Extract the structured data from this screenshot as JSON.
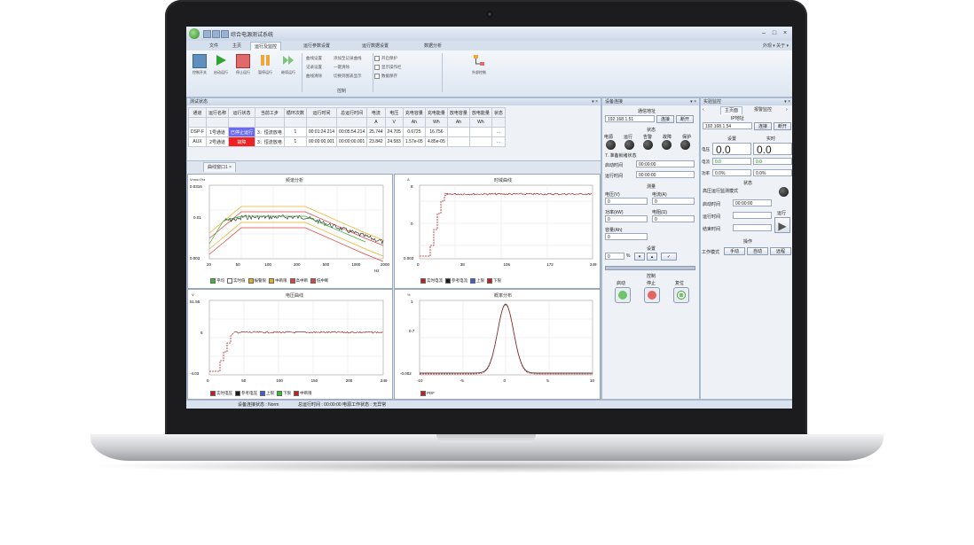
{
  "window": {
    "title": "综合电源测试系统",
    "min": "–",
    "max": "□",
    "close": "×"
  },
  "ribbon_tabs": [
    "文件",
    "主页",
    "运行及监控",
    "运行参数设置",
    "运行数据设置",
    "数据分析"
  ],
  "ribbon_right": "外观 ▾ 关于 ▾",
  "toolbar": {
    "buttons": [
      "控制开关",
      "启动运行",
      "停止运行",
      "暂停运行",
      "继续运行"
    ],
    "group_label": "控制",
    "col2": [
      "曲线设置",
      "记录设置",
      "曲线清除"
    ],
    "col3": [
      "添加至记录曲线",
      "一键清除",
      "切换到图表显示"
    ],
    "checks": [
      "开启保护",
      "显示操作栏",
      "数据保存"
    ],
    "right_icon_label": "外部控制"
  },
  "test_panel": {
    "title": "测试状态",
    "headers": [
      "通道",
      "运行名称",
      "运行状态",
      "当前工步",
      "循环次数",
      "运行时间",
      "总运行时间",
      "电流",
      "电压",
      "充电容量",
      "充电能量",
      "放电容量",
      "放电能量",
      "状态"
    ],
    "units": [
      "",
      "",
      "",
      "",
      "",
      "",
      "",
      "A",
      "V",
      "Ah",
      "Wh",
      "Ah",
      "Wh",
      ""
    ],
    "rows": [
      [
        "DSP-F",
        "1号通道",
        "已停止运行",
        "3：恒流放电",
        "1",
        "00:01:24.214",
        "00:05:54.214",
        "25.744",
        "24.705",
        "0.6725",
        "16.756",
        "",
        "",
        "…"
      ],
      [
        "AUX",
        "2号通道",
        "故障",
        "3：恒流放电",
        "1",
        "00:00:00.001",
        "00:00:00.001",
        "23.842",
        "24.583",
        "1.57e-05",
        "4.85e-05",
        "",
        "",
        "…"
      ]
    ]
  },
  "chart_tab": "曲线窗口1",
  "charts": {
    "c1": {
      "title": "频谱分析",
      "ylabel": "Vrms/√Hz",
      "xlabel": "Hz",
      "yticks": [
        "0.0316",
        "0.01",
        "0.003"
      ],
      "xticks": [
        "20",
        "50",
        "100",
        "200",
        "500",
        "1000",
        "2000"
      ],
      "legend": [
        "平均",
        "实时值",
        "报警限",
        "中断限",
        "高中断",
        "低中断"
      ]
    },
    "c2": {
      "title": "时域曲线",
      "ylabel": "A",
      "yticks": [
        "8",
        "0",
        "0.003"
      ],
      "xticks": [
        "0",
        "38",
        "106",
        "172",
        "249"
      ],
      "legend": [
        "实时电流",
        "参考电流",
        "上限",
        "下限"
      ]
    },
    "c3": {
      "title": "电压曲线",
      "ylabel": "V",
      "yticks": [
        "51.55",
        "6",
        "-4.03"
      ],
      "xticks": [
        "0",
        "50",
        "100",
        "150",
        "200",
        "249"
      ],
      "legend": [
        "实时电压",
        "参考电压",
        "上限",
        "下限",
        "中断限"
      ]
    },
    "c4": {
      "title": "概率分布",
      "ylabel": "%",
      "yticks": [
        "1",
        "0.7",
        "-0.002"
      ],
      "xticks": [
        "-10",
        "-5",
        "0",
        "5",
        "10"
      ],
      "legend": [
        "PDF"
      ]
    }
  },
  "conn_panel": {
    "title": "设备连接",
    "addr_label": "通信地址",
    "ip": "192.168.1.51",
    "connect": "连接",
    "disconnect": "断开",
    "status_label": "状态",
    "lights": [
      "电源",
      "运行",
      "告警",
      "故障",
      "保护"
    ],
    "msg": "7. 准备就绪状态",
    "time1_label": "启动时间",
    "time1": "00:00:00",
    "time2_label": "运行时间",
    "time2": "00:00:00",
    "meas_label": "测量",
    "v1_label": "电压(V)",
    "v1": "0",
    "v2_label": "电流(A)",
    "v2": "0",
    "v3_label": "功率(kW)",
    "v3": "0",
    "v4_label": "电阻(Ω)",
    "v4": "0",
    "v5_label": "容量(Ah)",
    "v5": "0",
    "step_label": "设置",
    "step_val": "0",
    "step_unit": "%",
    "ctrl_label": "控制",
    "ctrl_btns": [
      "启动",
      "停止",
      "复位"
    ]
  },
  "right_panel": {
    "title": "实验监控",
    "tabs": [
      "主页面",
      "报警监控"
    ],
    "addr_label": "IP地址",
    "ip": "192.168.1.54",
    "connect": "连接",
    "disconnect": "断开",
    "col1": "设置",
    "col2": "实时",
    "rows": [
      {
        "label": "电压",
        "set": "0.0",
        "real": "0.0"
      },
      {
        "label": "电流",
        "set": "0.0",
        "real": "0.0"
      },
      {
        "label": "功率",
        "set": "0.0%",
        "real": "0.0%"
      }
    ],
    "status_label": "状态",
    "mode": "高压运行监测模式",
    "t1_label": "启动时间",
    "t1": "00:00:00",
    "t2_label": "运行时间",
    "t3_label": "结束时间",
    "run_label": "运行",
    "op_label": "操作",
    "op_row_label": "工作模式",
    "op_btns": [
      "手动",
      "自动",
      "远程"
    ]
  },
  "statusbar": {
    "left": "设备连接状态 : Norm",
    "right": "总运行时间 : 00:00:00 电源工作状态 : 无异常"
  }
}
